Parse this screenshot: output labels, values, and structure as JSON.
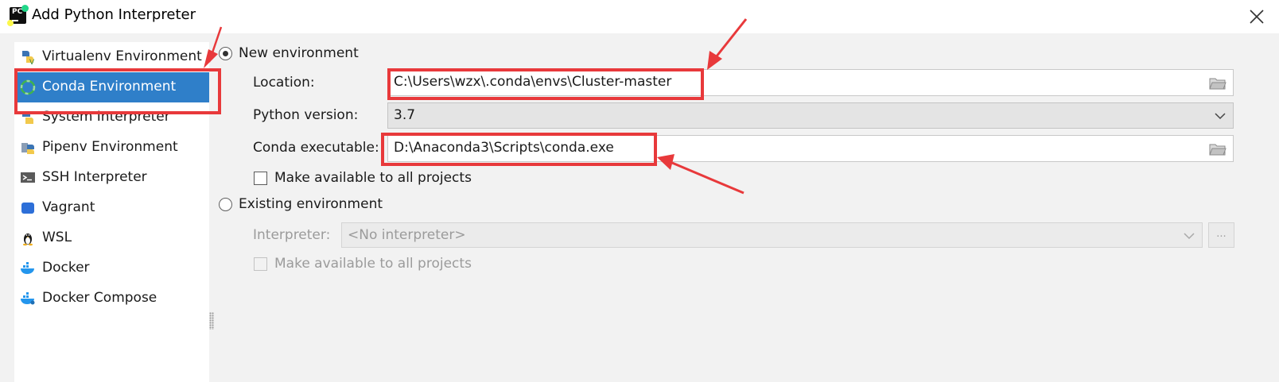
{
  "window": {
    "title": "Add Python Interpreter",
    "app_icon_text": "PC"
  },
  "sidebar": {
    "items": [
      {
        "label": "Virtualenv Environment",
        "icon": "virtualenv-icon"
      },
      {
        "label": "Conda Environment",
        "icon": "conda-icon",
        "selected": true
      },
      {
        "label": "System Interpreter",
        "icon": "python-icon"
      },
      {
        "label": "Pipenv Environment",
        "icon": "pipenv-icon"
      },
      {
        "label": "SSH Interpreter",
        "icon": "terminal-icon"
      },
      {
        "label": "Vagrant",
        "icon": "vagrant-icon"
      },
      {
        "label": "WSL",
        "icon": "linux-penguin-icon"
      },
      {
        "label": "Docker",
        "icon": "docker-icon"
      },
      {
        "label": "Docker Compose",
        "icon": "docker-compose-icon"
      }
    ]
  },
  "new_env": {
    "radio_label": "New environment",
    "selected": true,
    "location_label": "Location:",
    "location_value": "C:\\Users\\wzx\\.conda\\envs\\Cluster-master",
    "python_version_label": "Python version:",
    "python_version_value": "3.7",
    "conda_exe_label": "Conda executable:",
    "conda_exe_value": "D:\\Anaconda3\\Scripts\\conda.exe",
    "make_available_label": "Make available to all projects",
    "make_available_checked": false
  },
  "existing_env": {
    "radio_label": "Existing environment",
    "selected": false,
    "interpreter_label": "Interpreter:",
    "interpreter_value": "<No interpreter>",
    "browse_label": "...",
    "make_available_label": "Make available to all projects",
    "make_available_checked": false
  },
  "colors": {
    "selection": "#2f7fc9",
    "annotation": "#e8393b",
    "background": "#f2f2f2"
  }
}
